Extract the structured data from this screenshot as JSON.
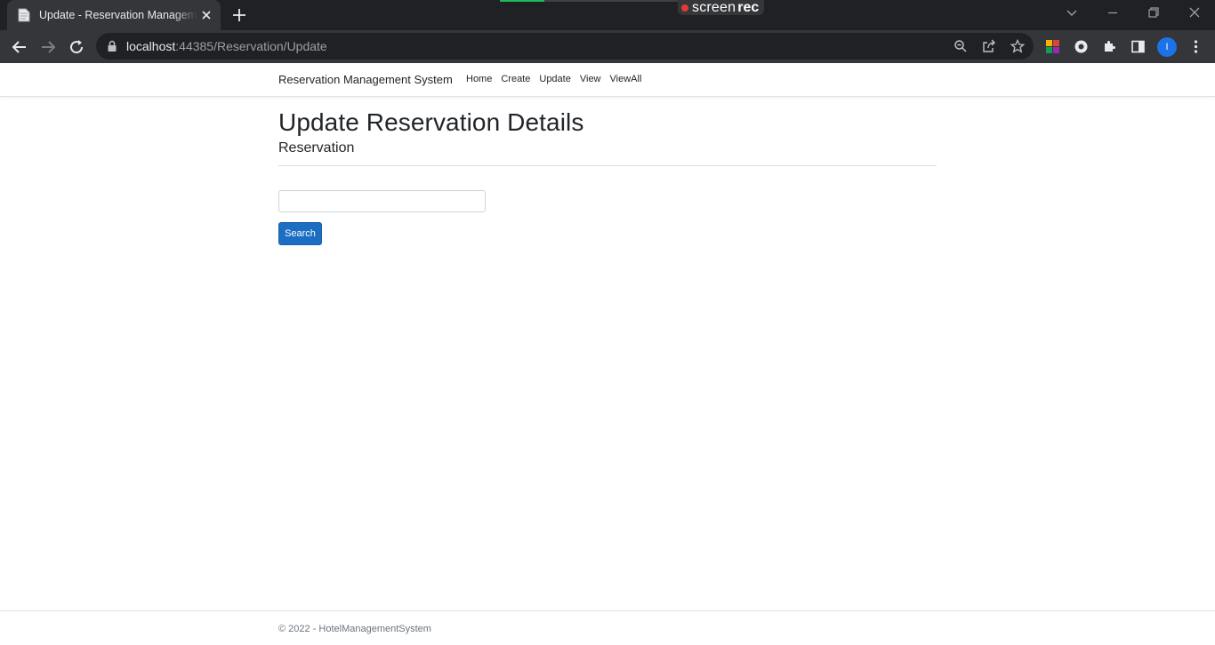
{
  "browser": {
    "tab_title": "Update - Reservation Management System",
    "url_host": "localhost",
    "url_rest": ":44385/Reservation/Update",
    "profile_initial": "I",
    "screenrec_word1": "screen",
    "screenrec_word2": "rec"
  },
  "navbar": {
    "brand": "Reservation Management System",
    "links": [
      "Home",
      "Create",
      "Update",
      "View",
      "ViewAll"
    ]
  },
  "main": {
    "title": "Update Reservation Details",
    "subtitle": "Reservation",
    "search_value": "",
    "search_button": "Search"
  },
  "footer": {
    "text": "© 2022 - HotelManagementSystem"
  },
  "colors": {
    "primary_button": "#1b6ec2",
    "chrome_dark": "#202124",
    "chrome_toolbar": "#35363a"
  }
}
